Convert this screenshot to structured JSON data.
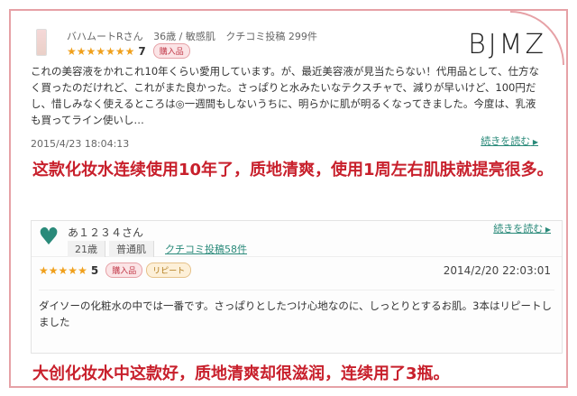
{
  "brand": "BJMZ",
  "review1": {
    "user_meta": [
      "バハムートRさん",
      "36歳 / 敏感肌",
      "クチコミ投稿 299件"
    ],
    "rating": "7",
    "purchase_badge": "購入品",
    "body": "これの美容液をかれこれ10年くらい愛用しています。が、最近美容液が見当たらない！代用品として、仕方なく買ったのだけれど、これがまた良かった。さっぱりと水みたいなテクスチャで、減りが早いけど、100円だし、惜しみなく使えるところは◎一週間もしないうちに、明らかに肌が明るくなってきました。今度は、乳液も買ってライン使いし…",
    "date": "2015/4/23 18:04:13",
    "more_link": "続きを読む"
  },
  "caption1": "这款化妆水连续使用10年了，质地清爽，使用1周左右肌肤就提亮很多。",
  "review2": {
    "name": "あ１２３４さん",
    "age": "21歳",
    "skin": "普通肌",
    "posts_link": "クチコミ投稿58件",
    "rating": "5",
    "purchase_badge": "購入品",
    "repeat_badge": "リピート",
    "date": "2014/2/20 22:03:01",
    "body": "ダイソーの化粧水の中では一番です。さっぱりとしたつけ心地なのに、しっとりとするお肌。3本はリピートしました",
    "more_link": "続きを読む"
  },
  "caption2": "大创化妆水中这款好，质地清爽却很滋润，连续用了3瓶。",
  "colors": {
    "frame": "#e6a1a6",
    "star": "#f0a01c",
    "caption": "#c8202c",
    "link": "#2a8a7a"
  },
  "icons": {
    "star": "star-icon",
    "heart": "heart-icon",
    "bottle": "bottle-icon"
  }
}
